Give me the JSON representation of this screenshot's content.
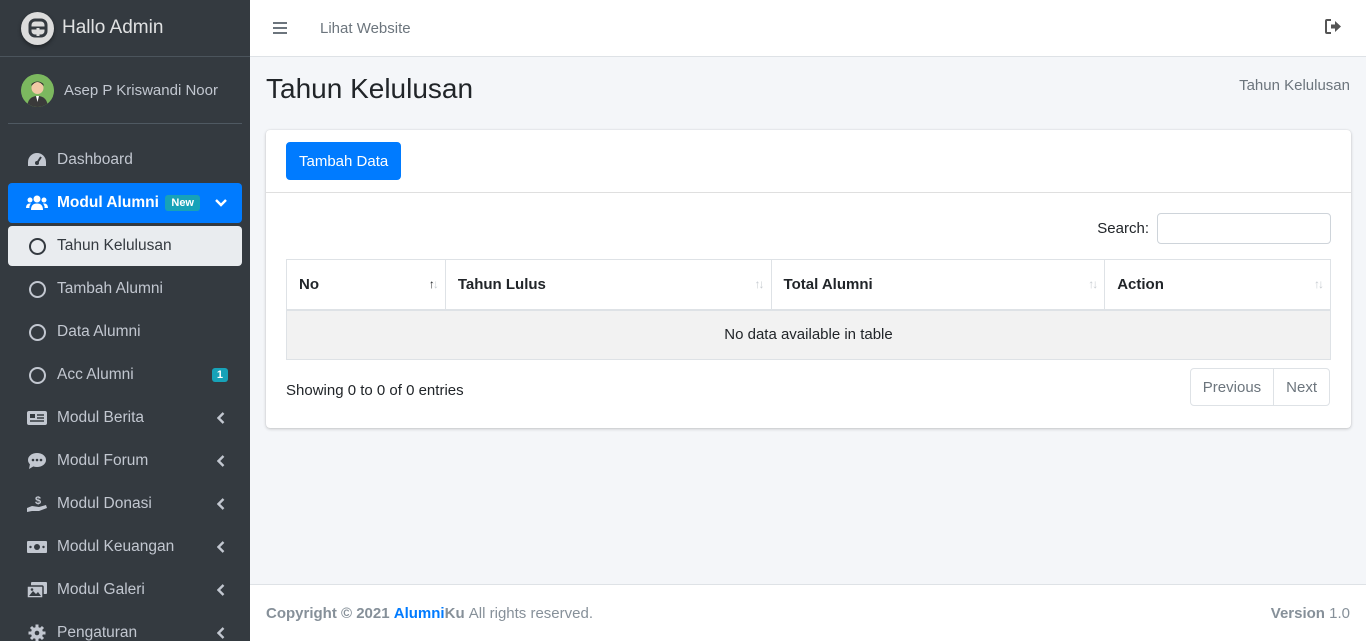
{
  "brand": {
    "title": "Hallo Admin",
    "icon": "app-logo-icon"
  },
  "user": {
    "name": "Asep P Kriswandi Noor"
  },
  "sidebar": {
    "items": [
      {
        "label": "Dashboard",
        "icon": "tachometer-icon"
      },
      {
        "label": "Modul Alumni",
        "icon": "users-icon",
        "badge": "New"
      },
      {
        "label": "Tahun Kelulusan"
      },
      {
        "label": "Tambah Alumni"
      },
      {
        "label": "Data Alumni"
      },
      {
        "label": "Acc Alumni",
        "badge": "1"
      },
      {
        "label": "Modul Berita",
        "icon": "newspaper-icon"
      },
      {
        "label": "Modul Forum",
        "icon": "comment-icon"
      },
      {
        "label": "Modul Donasi",
        "icon": "hand-dollar-icon"
      },
      {
        "label": "Modul Keuangan",
        "icon": "money-bill-icon"
      },
      {
        "label": "Modul Galeri",
        "icon": "images-icon"
      },
      {
        "label": "Pengaturan",
        "icon": "cog-icon"
      }
    ]
  },
  "header": {
    "link": "Lihat Website"
  },
  "page": {
    "title": "Tahun Kelulusan",
    "breadcrumb": "Tahun Kelulusan"
  },
  "card": {
    "add_button": "Tambah Data",
    "search_label": "Search:",
    "search_value": "",
    "columns": [
      "No",
      "Tahun Lulus",
      "Total Alumni",
      "Action"
    ],
    "empty_text": "No data available in table",
    "info": "Showing 0 to 0 of 0 entries",
    "prev": "Previous",
    "next": "Next"
  },
  "footer": {
    "copyright": "Copyright © 2021",
    "brand_a": "Alumni",
    "brand_b": "Ku",
    "rights": "All rights reserved.",
    "version_label": "Version",
    "version": "1.0"
  },
  "colors": {
    "accent": "#007bff",
    "sidebar": "#343a40",
    "badge": "#17a2b8"
  }
}
